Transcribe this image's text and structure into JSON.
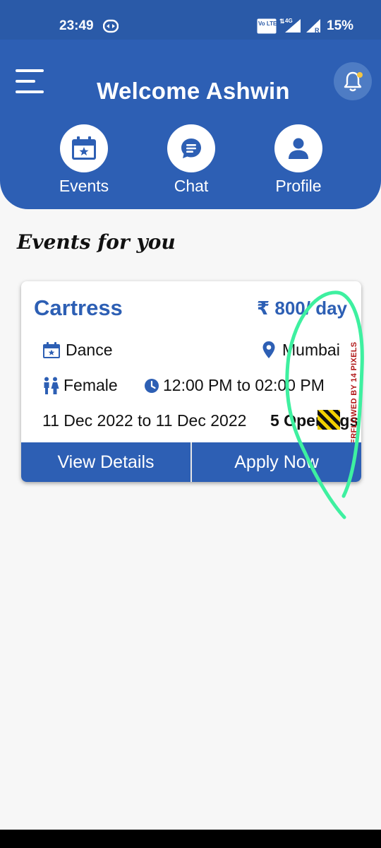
{
  "status_bar": {
    "time": "23:49",
    "volte_label": "Vo LTE 1",
    "network": "4G",
    "battery": "15%"
  },
  "header": {
    "welcome": "Welcome Ashwin",
    "nav": [
      {
        "label": "Events",
        "icon": "calendar-star-icon"
      },
      {
        "label": "Chat",
        "icon": "chat-bubble-icon"
      },
      {
        "label": "Profile",
        "icon": "person-icon"
      }
    ]
  },
  "section_title": "Events for you",
  "event_card": {
    "title": "Cartress",
    "price": "₹ 800/ day",
    "category": "Dance",
    "location": "Mumbai",
    "gender": "Female",
    "time_range": "12:00 PM to 02:00 PM",
    "dates": "11 Dec 2022 to 11 Dec 2022",
    "openings": "5 Openings",
    "view_details": "View Details",
    "apply_now": "Apply Now",
    "overflow_warning": "RIGHT OVERFLOWED BY 14 PIXELS"
  },
  "colors": {
    "primary": "#2d5fb4",
    "status_bar": "#2a5aa8",
    "bell_button": "#4e7cc4",
    "notification_dot": "#f4c542",
    "scribble": "#3ef0a0",
    "overflow_warning": "#b01818"
  }
}
